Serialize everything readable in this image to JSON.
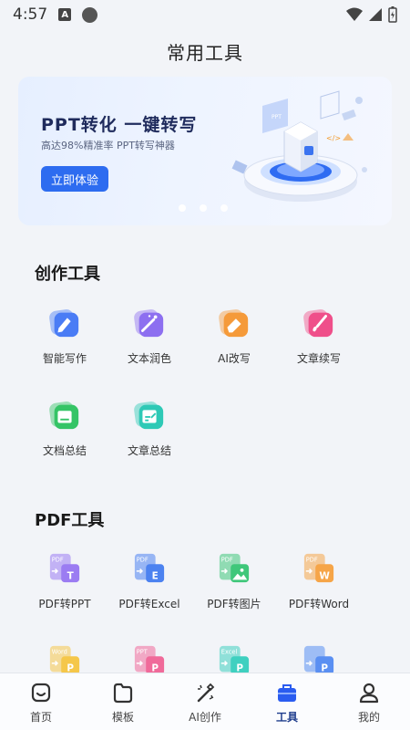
{
  "status": {
    "time": "4:57",
    "notif_letter": "A"
  },
  "header": {
    "title": "常用工具"
  },
  "banner": {
    "title": "PPT转化 一键转写",
    "subtitle": "高达98%精准率 PPT转写神器",
    "button": "立即体验",
    "art_label": "PPT",
    "slide_count": 3,
    "active_slide": 1
  },
  "creation": {
    "title": "创作工具",
    "items": [
      {
        "label": "智能写作",
        "icon": "pen-icon",
        "color": "#4a7cf5"
      },
      {
        "label": "文本润色",
        "icon": "magic-wand-icon",
        "color": "#8d6ff0"
      },
      {
        "label": "AI改写",
        "icon": "eraser-icon",
        "color": "#f59a3a"
      },
      {
        "label": "文章续写",
        "icon": "brush-icon",
        "color": "#ef4f8a"
      },
      {
        "label": "文档总结",
        "icon": "doc-summary-icon",
        "color": "#35c466"
      },
      {
        "label": "文章总结",
        "icon": "article-summary-icon",
        "color": "#2ec9b6"
      }
    ]
  },
  "pdf": {
    "title": "PDF工具",
    "items": [
      {
        "label": "PDF转PPT",
        "icon": "pdf-to-ppt-icon",
        "badge": "T",
        "src": "PDF",
        "color": "#9b7cf2"
      },
      {
        "label": "PDF转Excel",
        "icon": "pdf-to-excel-icon",
        "badge": "E",
        "src": "PDF",
        "color": "#4c82f0"
      },
      {
        "label": "PDF转图片",
        "icon": "pdf-to-image-icon",
        "badge": "",
        "src": "PDF",
        "color": "#3fc77a"
      },
      {
        "label": "PDF转Word",
        "icon": "pdf-to-word-icon",
        "badge": "W",
        "src": "PDF",
        "color": "#f6a548"
      },
      {
        "label": "",
        "icon": "word-to-pdf-icon",
        "badge": "P",
        "src": "Word",
        "color": "#f5c74a"
      },
      {
        "label": "",
        "icon": "ppt-to-pdf-icon",
        "badge": "P",
        "src": "PPT",
        "color": "#f06a9a"
      },
      {
        "label": "",
        "icon": "excel-to-pdf-icon",
        "badge": "P",
        "src": "Excel",
        "color": "#3fd0c0"
      },
      {
        "label": "",
        "icon": "image-to-pdf-icon",
        "badge": "P",
        "src": "",
        "color": "#5a8ff2"
      }
    ]
  },
  "nav": {
    "items": [
      {
        "label": "首页",
        "icon": "home-icon"
      },
      {
        "label": "模板",
        "icon": "template-icon"
      },
      {
        "label": "AI创作",
        "icon": "ai-create-icon"
      },
      {
        "label": "工具",
        "icon": "toolbox-icon",
        "active": true
      },
      {
        "label": "我的",
        "icon": "profile-icon"
      }
    ]
  },
  "colors": {
    "accent": "#2d6cf0",
    "nav_active": "#2a5cf0",
    "background": "#f2f4f8"
  }
}
